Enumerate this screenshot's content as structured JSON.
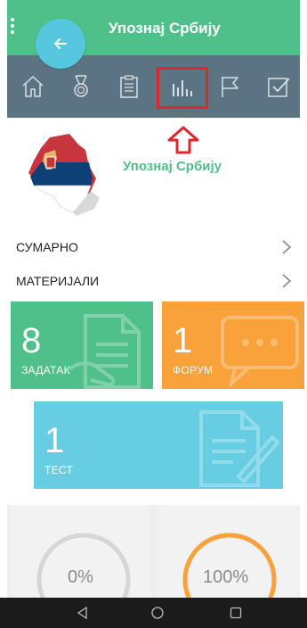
{
  "app": {
    "title": "Упознај Србију"
  },
  "toolbar": {
    "back_icon": "arrow-left-icon",
    "menu_icon": "more-vert-icon"
  },
  "tabs": [
    {
      "icon": "home-icon"
    },
    {
      "icon": "medal-icon"
    },
    {
      "icon": "clipboard-icon"
    },
    {
      "icon": "bar-chart-icon",
      "highlighted": true
    },
    {
      "icon": "flag-icon"
    },
    {
      "icon": "checkbox-icon"
    }
  ],
  "course": {
    "name": "Упознај Србију",
    "image_icon": "serbia-flag-map-icon"
  },
  "sections": [
    {
      "label": "СУМАРНО"
    },
    {
      "label": "МАТЕРИЈАЛИ"
    }
  ],
  "tiles": {
    "tasks": {
      "count": "8",
      "label": "ЗАДАТАК",
      "color": "#4fc08a"
    },
    "forum": {
      "count": "1",
      "label": "ФОРУМ",
      "color": "#f9a23b"
    },
    "test": {
      "count": "1",
      "label": "ТЕСТ",
      "color": "#67cde2"
    }
  },
  "progress": [
    {
      "text": "0%",
      "value": 0
    },
    {
      "text": "100%",
      "value": 1.0
    }
  ],
  "colors": {
    "accent": "#4fc08a",
    "tabbar": "#5b7382",
    "highlight": "#e0262d",
    "fab": "#56c7df"
  }
}
